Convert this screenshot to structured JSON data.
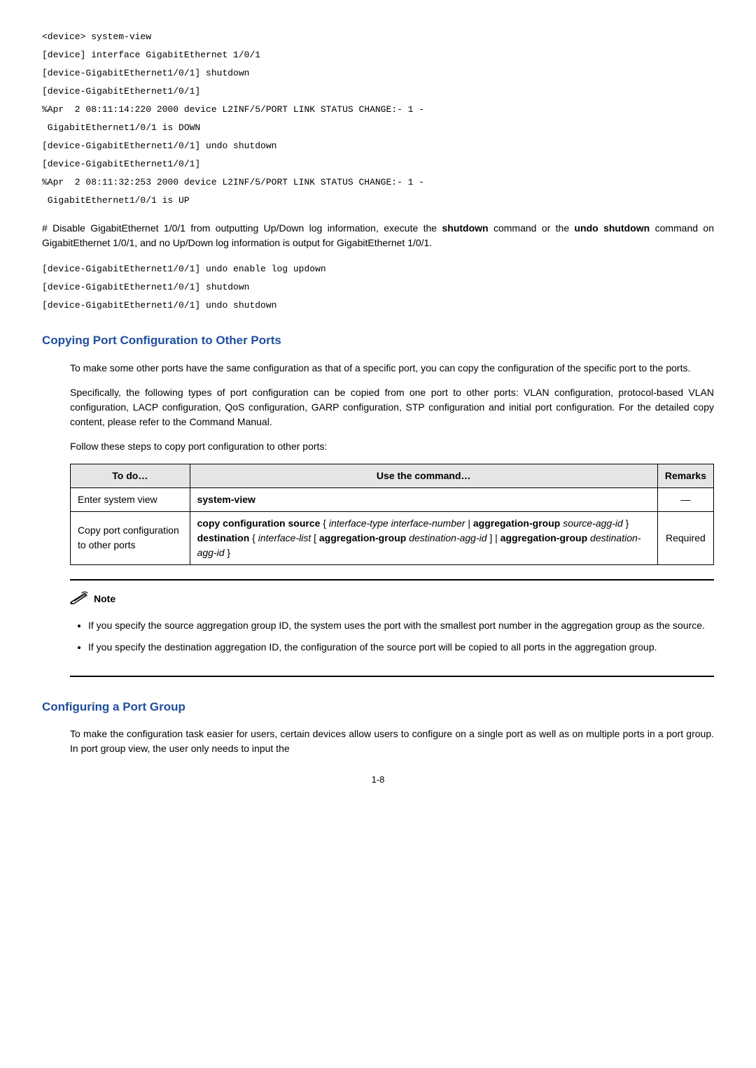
{
  "code1": "<device> system-view\n[device] interface GigabitEthernet 1/0/1\n[device-GigabitEthernet1/0/1] shutdown\n[device-GigabitEthernet1/0/1]\n%Apr  2 08:11:14:220 2000 device L2INF/5/PORT LINK STATUS CHANGE:- 1 -\n GigabitEthernet1/0/1 is DOWN\n[device-GigabitEthernet1/0/1] undo shutdown\n[device-GigabitEthernet1/0/1]\n%Apr  2 08:11:32:253 2000 device L2INF/5/PORT LINK STATUS CHANGE:- 1 -\n GigabitEthernet1/0/1 is UP",
  "para1_a": "# Disable GigabitEthernet 1/0/1 from outputting Up/Down log information, execute the ",
  "para1_b": "shutdown",
  "para1_c": " command or the ",
  "para1_d": "undo shutdown",
  "para1_e": " command on GigabitEthernet 1/0/1, and no Up/Down log information is output for GigabitEthernet 1/0/1.",
  "code2": "[device-GigabitEthernet1/0/1] undo enable log updown\n[device-GigabitEthernet1/0/1] shutdown\n[device-GigabitEthernet1/0/1] undo shutdown",
  "heading1": "Copying Port Configuration to Other Ports",
  "para2": "To make some other ports have the same configuration as that of a specific port, you can copy the configuration of the specific port to the ports.",
  "para3": "Specifically, the following types of port configuration can be copied from one port to other ports: VLAN configuration, protocol-based VLAN configuration, LACP configuration, QoS configuration, GARP configuration, STP configuration and initial port configuration. For the detailed copy content, please refer to the Command Manual.",
  "para4": "Follow these steps to copy port configuration to other ports:",
  "table": {
    "header": {
      "c1": "To do…",
      "c2": "Use the command…",
      "c3": "Remarks"
    },
    "row1": {
      "c1": "Enter system view",
      "c2": "system-view",
      "c3": "—"
    },
    "row2": {
      "c1": "Copy port configuration to other ports",
      "c2": {
        "s1": "copy configuration source",
        "s2": " { ",
        "s3": "interface-type interface-number",
        "s4": " | ",
        "s5": "aggregation-group",
        "s6": " ",
        "s7": "source-agg-id",
        "s8": " } ",
        "s9": "destination",
        "s10": " { ",
        "s11": "interface-list",
        "s12": " [ ",
        "s13": "aggregation-group",
        "s14": " ",
        "s15": "destination-agg-id",
        "s16": " ] | ",
        "s17": "aggregation-group",
        "s18": " ",
        "s19": "destination-agg-id",
        "s20": " }"
      },
      "c3": "Required"
    }
  },
  "note": {
    "label": "Note",
    "bullet1": "If you specify the source aggregation group ID, the system uses the port with the smallest port number in the aggregation group as the source.",
    "bullet2": "If you specify the destination aggregation ID, the configuration of the source port will be copied to all ports in the aggregation group."
  },
  "heading2": "Configuring a Port Group",
  "para5": "To make the configuration task easier for users, certain devices allow users to configure on a single port as well as on multiple ports in a port group. In port group view, the user only needs to input the",
  "pagenum": "1-8"
}
